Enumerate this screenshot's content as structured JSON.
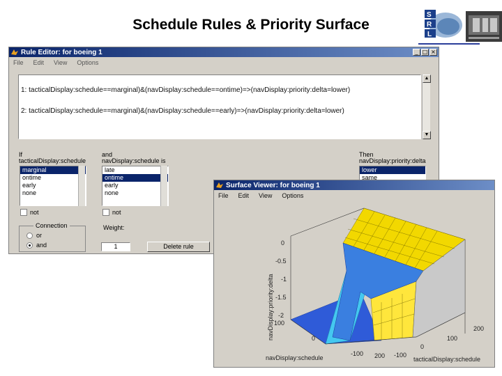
{
  "slide": {
    "title": "Schedule Rules & Priority Surface"
  },
  "logos": {
    "left_text": "SRL"
  },
  "rule_editor": {
    "title": "Rule Editor: for boeing 1",
    "menu": [
      "File",
      "Edit",
      "View",
      "Options"
    ],
    "rules": [
      "1: tacticalDisplay:schedule==marginal)&(navDisplay:schedule==ontime)=>(navDisplay:priority:delta=lower)",
      "2: tacticalDisplay:schedule==marginal)&(navDisplay:schedule==early)=>(navDisplay:priority:delta=lower)"
    ],
    "if_col": {
      "label1": "If",
      "label2": "tacticalDisplay:schedule",
      "options": [
        "marginal",
        "ontime",
        "early",
        "none"
      ],
      "selected": 0,
      "not_label": "not"
    },
    "and_col": {
      "label1": "and",
      "label2": "navDisplay:schedule is",
      "options": [
        "late",
        "ontime",
        "early",
        "none"
      ],
      "selected": 1,
      "not_label": "not"
    },
    "then_col": {
      "label1": "Then",
      "label2": "navDisplay:priority:delta",
      "options": [
        "lower",
        "same"
      ],
      "selected": 0
    },
    "connection": {
      "title": "Connection",
      "or_label": "or",
      "and_label": "and",
      "selected": "and"
    },
    "weight": {
      "label": "Weight:",
      "value": "1"
    },
    "delete_button": "Delete rule"
  },
  "surface_viewer": {
    "title": "Surface Viewer: for boeing 1",
    "menu": [
      "File",
      "Edit",
      "View",
      "Options"
    ],
    "z_label": "navDisplay:priority:delta",
    "z_ticks": [
      "0",
      "-0.5",
      "-1",
      "-1.5",
      "-2"
    ],
    "y_label": "navDisplay:schedule",
    "y_ticks": [
      "100",
      "0",
      "-100"
    ],
    "x_label": "tacticalDisplay:schedule",
    "x_ticks": [
      "200",
      "100",
      "0",
      "-100",
      "200"
    ],
    "colors": {
      "low": "#2f5bd8",
      "mid": "#ffe63c",
      "high": "#f2d800",
      "cyan": "#44c8f0"
    }
  }
}
